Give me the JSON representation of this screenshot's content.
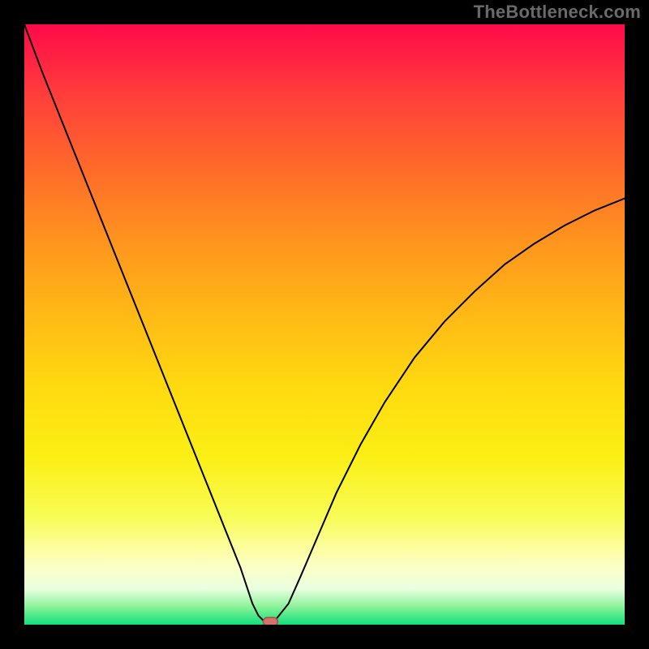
{
  "watermark": "TheBottleneck.com",
  "chart_data": {
    "type": "line",
    "title": "",
    "xlabel": "",
    "ylabel": "",
    "xlim": [
      0,
      100
    ],
    "ylim": [
      0,
      100
    ],
    "grid": false,
    "legend": false,
    "series": [
      {
        "name": "curve",
        "x": [
          0,
          3,
          6,
          9,
          12,
          15,
          18,
          21,
          24,
          27,
          30,
          33,
          36,
          38,
          39,
          40,
          41,
          42,
          44,
          46,
          49,
          52,
          56,
          60,
          65,
          70,
          75,
          80,
          85,
          90,
          95,
          100
        ],
        "y": [
          100,
          92,
          84.5,
          77,
          69.5,
          62,
          54.5,
          47,
          39.5,
          32,
          24.5,
          17,
          9.5,
          3.5,
          1.5,
          0.5,
          0.5,
          1,
          3.5,
          8,
          15,
          22,
          30,
          37,
          44.5,
          50.5,
          55.5,
          60,
          63.5,
          66.5,
          69,
          71
        ]
      }
    ],
    "marker": {
      "x": 41,
      "y": 0.5
    },
    "background": {
      "type": "gradient",
      "stops": [
        "#ff0a4a",
        "#ff941e",
        "#ffd910",
        "#fdffc3",
        "#0fe07a"
      ]
    }
  }
}
